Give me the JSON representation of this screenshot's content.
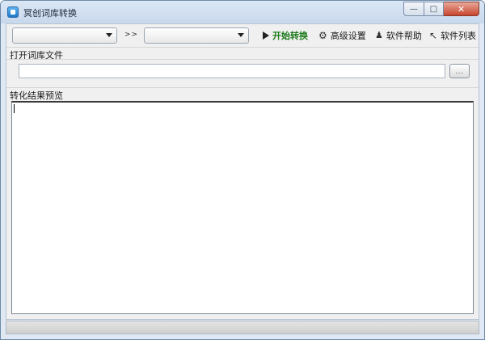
{
  "window": {
    "title": "冥创词库转换",
    "minimize_icon": "minimize-icon",
    "maximize_icon": "maximize-icon",
    "close_icon": "close-icon"
  },
  "toolbar": {
    "source_format_value": "",
    "target_format_value": "",
    "arrow_text": ">>",
    "start_label": "开始转换",
    "settings_label": "高级设置",
    "help_label": "软件帮助",
    "list_label": "软件列表"
  },
  "open_section": {
    "label": "打开词库文件",
    "path_value": "",
    "browse_label": "..."
  },
  "preview_section": {
    "label": "转化结果预览",
    "content": ""
  },
  "status": {
    "text": ""
  },
  "colors": {
    "start_text": "#1e7b1e",
    "window_border": "#6f8aa8",
    "close_button": "#c8442e"
  }
}
